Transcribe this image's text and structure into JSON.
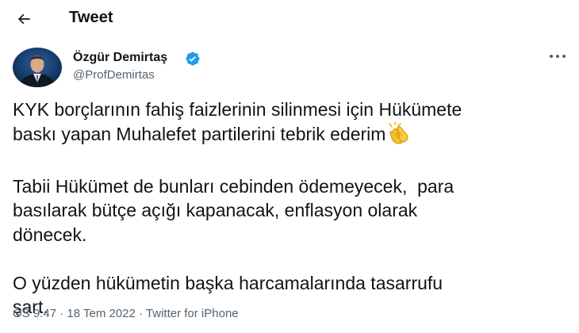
{
  "header": {
    "title": "Tweet",
    "back_icon": "arrow-left-icon"
  },
  "author": {
    "name": "Özgür Demirtaş",
    "handle": "@ProfDemirtas",
    "verified_icon": "verified-badge-icon",
    "verified_color": "#1d9bf0"
  },
  "more_icon": "more-horizontal-icon",
  "tweet": {
    "paragraphs": [
      {
        "lines": [
          "KYK borçlarının fahiş faizlerinin silinmesi için Hükümete",
          "baskı yapan Muhalefet partilerini tebrik ederim"
        ],
        "trailing_emoji": "clapping-hands-emoji"
      },
      {
        "lines": [
          "Tabii Hükümet de bunları cebinden ödemeyecek,  para",
          "basılarak bütçe açığı kapanacak, enflasyon olarak",
          "dönecek."
        ]
      },
      {
        "lines": [
          "O yüzden hükümetin başka harcamalarında tasarrufu",
          "şart."
        ]
      }
    ]
  },
  "meta": {
    "time": "ÖS 9:47",
    "date": "18 Tem 2022",
    "source": "Twitter for iPhone",
    "separator": " · "
  },
  "colors": {
    "text": "#0f1419",
    "secondary": "#536471",
    "accent": "#1d9bf0"
  }
}
